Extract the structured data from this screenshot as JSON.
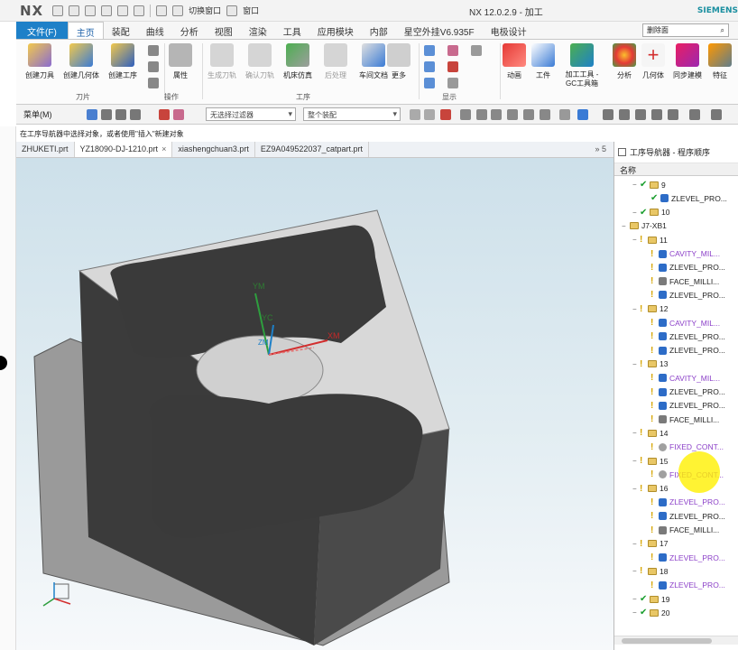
{
  "app": {
    "logo": "NX",
    "title": "NX 12.0.2.9 - 加工",
    "brand": "SIEMENS",
    "quick_access": [
      "切换窗口",
      "窗口"
    ]
  },
  "ribbon_tabs": [
    {
      "label": "文件(F)"
    },
    {
      "label": "主页"
    },
    {
      "label": "装配"
    },
    {
      "label": "曲线"
    },
    {
      "label": "分析"
    },
    {
      "label": "视图"
    },
    {
      "label": "渲染"
    },
    {
      "label": "工具"
    },
    {
      "label": "应用模块"
    },
    {
      "label": "内部"
    },
    {
      "label": "星空外挂V6.935F"
    },
    {
      "label": "电极设计"
    }
  ],
  "search": {
    "value": "删除面"
  },
  "ribbon": {
    "buttons": [
      {
        "label": "创建刀具"
      },
      {
        "label": "创建几何体"
      },
      {
        "label": "创建工序"
      },
      {
        "label": "属性"
      },
      {
        "label": "生成刀轨"
      },
      {
        "label": "确认刀轨"
      },
      {
        "label": "机床仿真"
      },
      {
        "label": "后处理"
      },
      {
        "label": "车间文档"
      },
      {
        "label": "更多"
      },
      {
        "label": "动画"
      },
      {
        "label": "工件"
      },
      {
        "label": "加工工具 - GC工具箱"
      },
      {
        "label": "分析"
      },
      {
        "label": "几何体"
      },
      {
        "label": "同步建模"
      },
      {
        "label": "特征"
      }
    ],
    "groups": {
      "tools": "刀片",
      "ops": "操作",
      "process": "工序",
      "display": "显示"
    }
  },
  "toolbar2": {
    "menu_label": "菜单(M)",
    "filter": "无选择过滤器",
    "assembly": "整个装配"
  },
  "status_text": "在工序导航器中选择对象，或者使用\"插入\"新建对象",
  "doc_tabs": [
    {
      "label": "ZHUKETI.prt"
    },
    {
      "label": "YZ18090-DJ-1210.prt"
    },
    {
      "label": "xiashengchuan3.prt"
    },
    {
      "label": "EZ9A049522037_catpart.prt"
    }
  ],
  "doc_tabs_more": "» 5",
  "axes": {
    "ym": "YM",
    "yc": "YC",
    "xm": "XM",
    "zm": "ZM"
  },
  "navigator": {
    "title": "工序导航器 - 程序顺序",
    "col_name": "名称",
    "rows": [
      {
        "text": "9",
        "kind": "folder",
        "status": "check",
        "indent": 1
      },
      {
        "text": "ZLEVEL_PRO...",
        "kind": "op",
        "status": "check",
        "indent": 2
      },
      {
        "text": "10",
        "kind": "folder",
        "status": "check",
        "indent": 1
      },
      {
        "text": "J7-XB1",
        "kind": "group",
        "status": "",
        "indent": 0
      },
      {
        "text": "11",
        "kind": "folder",
        "status": "excl",
        "indent": 1
      },
      {
        "text": "CAVITY_MIL...",
        "kind": "op",
        "status": "excl",
        "indent": 2,
        "color": "purple"
      },
      {
        "text": "ZLEVEL_PRO...",
        "kind": "op",
        "status": "excl",
        "indent": 2
      },
      {
        "text": "FACE_MILLI...",
        "kind": "face",
        "status": "excl",
        "indent": 2
      },
      {
        "text": "ZLEVEL_PRO...",
        "kind": "op",
        "status": "excl",
        "indent": 2
      },
      {
        "text": "12",
        "kind": "folder",
        "status": "excl",
        "indent": 1
      },
      {
        "text": "CAVITY_MIL...",
        "kind": "op",
        "status": "excl",
        "indent": 2,
        "color": "purple"
      },
      {
        "text": "ZLEVEL_PRO...",
        "kind": "op",
        "status": "excl",
        "indent": 2
      },
      {
        "text": "ZLEVEL_PRO...",
        "kind": "op",
        "status": "excl",
        "indent": 2
      },
      {
        "text": "13",
        "kind": "folder",
        "status": "excl",
        "indent": 1
      },
      {
        "text": "CAVITY_MIL...",
        "kind": "op",
        "status": "excl",
        "indent": 2,
        "color": "purple"
      },
      {
        "text": "ZLEVEL_PRO...",
        "kind": "op",
        "status": "excl",
        "indent": 2
      },
      {
        "text": "ZLEVEL_PRO...",
        "kind": "op",
        "status": "excl",
        "indent": 2
      },
      {
        "text": "FACE_MILLI...",
        "kind": "face",
        "status": "excl",
        "indent": 2
      },
      {
        "text": "14",
        "kind": "folder",
        "status": "excl",
        "indent": 1
      },
      {
        "text": "FIXED_CONT...",
        "kind": "fixed",
        "status": "excl",
        "indent": 2,
        "color": "purple"
      },
      {
        "text": "15",
        "kind": "folder",
        "status": "excl",
        "indent": 1
      },
      {
        "text": "FIXED_CONT...",
        "kind": "fixed",
        "status": "excl",
        "indent": 2,
        "color": "purple"
      },
      {
        "text": "16",
        "kind": "folder",
        "status": "excl",
        "indent": 1
      },
      {
        "text": "ZLEVEL_PRO...",
        "kind": "op",
        "status": "excl",
        "indent": 2,
        "color": "purple"
      },
      {
        "text": "ZLEVEL_PRO...",
        "kind": "op",
        "status": "excl",
        "indent": 2
      },
      {
        "text": "FACE_MILLI...",
        "kind": "face",
        "status": "excl",
        "indent": 2
      },
      {
        "text": "17",
        "kind": "folder",
        "status": "excl",
        "indent": 1
      },
      {
        "text": "ZLEVEL_PRO...",
        "kind": "op",
        "status": "excl",
        "indent": 2,
        "color": "purple"
      },
      {
        "text": "18",
        "kind": "folder",
        "status": "excl",
        "indent": 1
      },
      {
        "text": "ZLEVEL_PRO...",
        "kind": "op",
        "status": "excl",
        "indent": 2,
        "color": "purple"
      },
      {
        "text": "19",
        "kind": "folder",
        "status": "check",
        "indent": 1
      },
      {
        "text": "20",
        "kind": "folder",
        "status": "check",
        "indent": 1
      }
    ]
  },
  "colors": {
    "file_tab": "#1e80c8",
    "check": "#1a9e2e",
    "warning": "#d6a500",
    "op_purple": "#8b3fc8",
    "part_dark": "#3b3b3b"
  }
}
